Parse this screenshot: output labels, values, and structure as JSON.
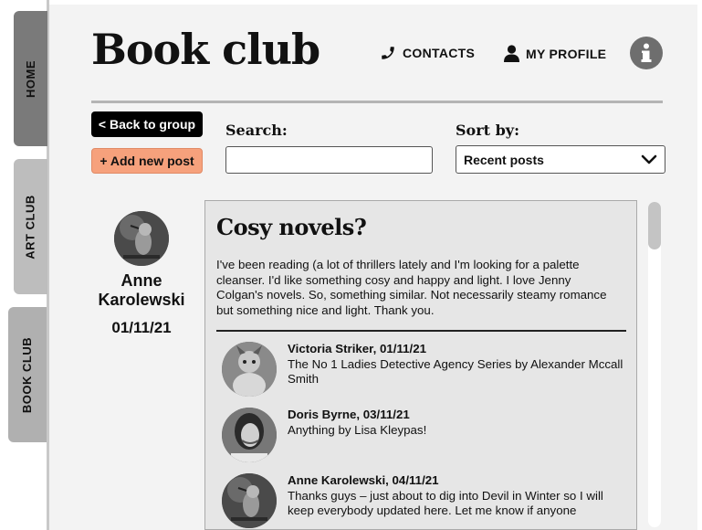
{
  "side_tabs": [
    {
      "label": "HOME"
    },
    {
      "label": "ART CLUB"
    },
    {
      "label": "BOOK CLUB"
    }
  ],
  "header": {
    "title": "Book club",
    "contacts_label": "CONTACTS",
    "profile_label": "MY PROFILE"
  },
  "toolbar": {
    "back_label": "< Back to group",
    "add_label": "+ Add new post",
    "search_label": "Search:",
    "search_value": "",
    "sort_label": "Sort by:",
    "sort_value": "Recent posts"
  },
  "post": {
    "author_name": "Anne Karolewski",
    "author_date": "01/11/21",
    "title": "Cosy novels?",
    "body": "I've been reading (a lot of thrillers lately and I'm looking for a palette cleanser. I'd like something cosy and happy and light. I love Jenny Colgan's novels. So, something similar. Not necessarily steamy romance but something nice and light. Thank you.",
    "comments": [
      {
        "header": "Victoria Striker, 01/11/21",
        "text": "The No 1 Ladies Detective Agency Series by Alexander Mccall Smith"
      },
      {
        "header": "Doris Byrne, 03/11/21",
        "text": "Anything by Lisa Kleypas!"
      },
      {
        "header": "Anne Karolewski, 04/11/21",
        "text": "Thanks guys – just about to dig into Devil in Winter so I will keep everybody updated here. Let me know if anyone"
      }
    ]
  },
  "icons": {
    "contacts": "phone-icon",
    "profile": "user-icon",
    "info": "info-icon",
    "sort": "chevron-down-icon"
  },
  "colors": {
    "back_button": "#000000",
    "add_button": "#f6a17c",
    "panel": "#f3f3f3",
    "info_circle": "#6e6e6e"
  }
}
